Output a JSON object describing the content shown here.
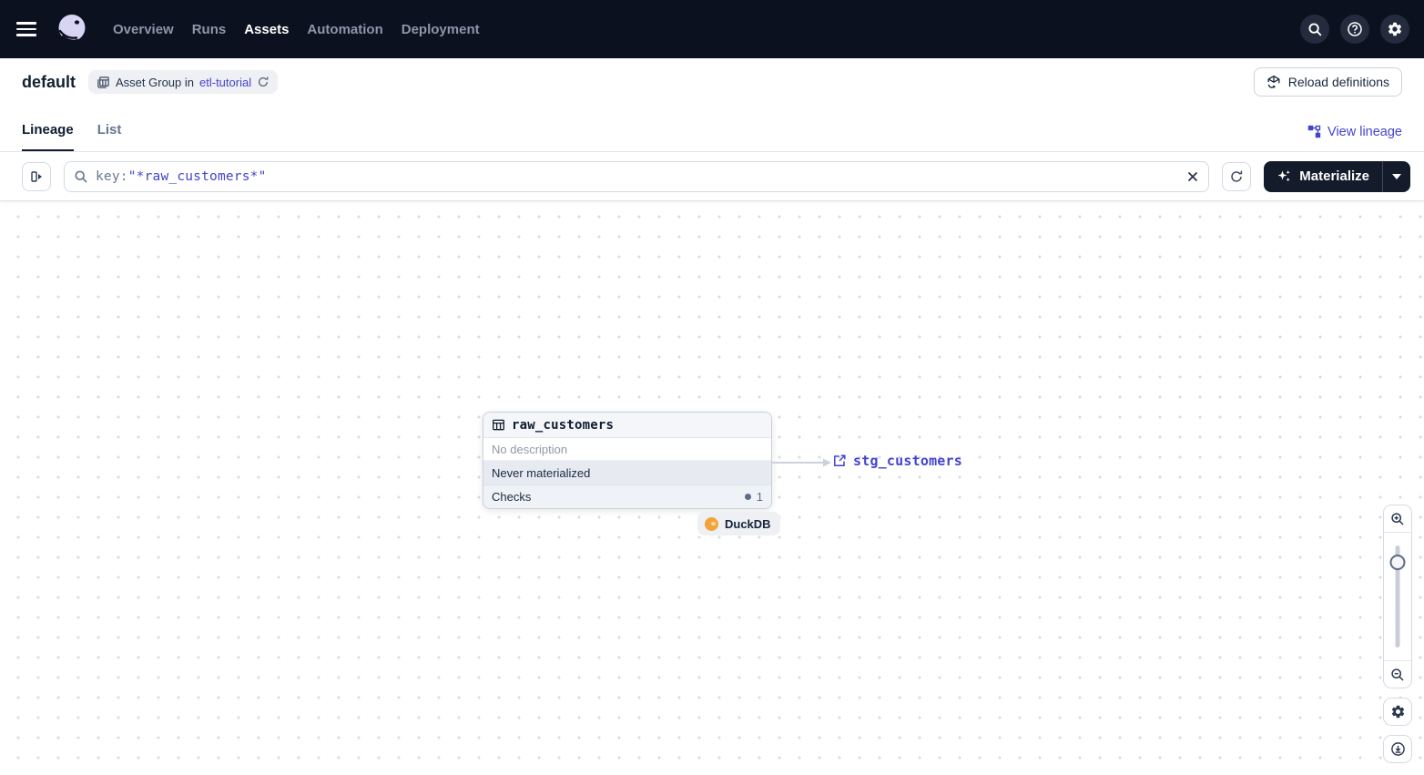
{
  "nav": {
    "items": [
      {
        "label": "Overview",
        "active": false
      },
      {
        "label": "Runs",
        "active": false
      },
      {
        "label": "Assets",
        "active": true
      },
      {
        "label": "Automation",
        "active": false
      },
      {
        "label": "Deployment",
        "active": false
      }
    ]
  },
  "header": {
    "title": "default",
    "group_badge": {
      "prefix": "Asset Group in",
      "link": "etl-tutorial"
    },
    "reload_button": "Reload definitions"
  },
  "tabs": {
    "lineage": "Lineage",
    "list": "List",
    "view_lineage": "View lineage"
  },
  "toolbar": {
    "search_prefix": "key:",
    "search_value": "\"*raw_customers*\"",
    "materialize": "Materialize"
  },
  "graph": {
    "node": {
      "title": "raw_customers",
      "description": "No description",
      "status": "Never materialized",
      "checks_label": "Checks",
      "checks_count": "1"
    },
    "kind_badge": "DuckDB",
    "downstream_link": "stg_customers"
  },
  "colors": {
    "nav_bg": "#0c111f",
    "accent_link": "#4443ce",
    "materialize_bg": "#141b2b",
    "status_row_bg": "#e7eaf1",
    "duckdb_yellow": "#f2a33c",
    "edge_gray": "#ccd1da"
  }
}
